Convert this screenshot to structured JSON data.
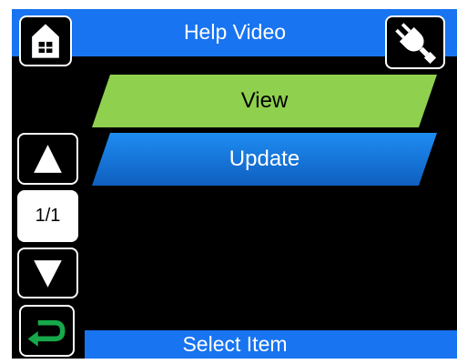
{
  "header": {
    "title": "Help Video",
    "left_icon": "home-icon",
    "right_icon": "plug-icon"
  },
  "menu": {
    "items": [
      {
        "label": "View",
        "color": "#8fd04f"
      },
      {
        "label": "Update",
        "color": "#1477e0"
      }
    ]
  },
  "pager": {
    "page_indicator": "1/1",
    "up_icon": "arrow-up-icon",
    "down_icon": "arrow-down-icon"
  },
  "footer": {
    "status": "Select Item",
    "back_icon": "back-return-icon"
  },
  "colors": {
    "background": "#000000",
    "accent_blue": "#1874f0",
    "view_green": "#8fd04f",
    "back_green": "#17a84a"
  }
}
